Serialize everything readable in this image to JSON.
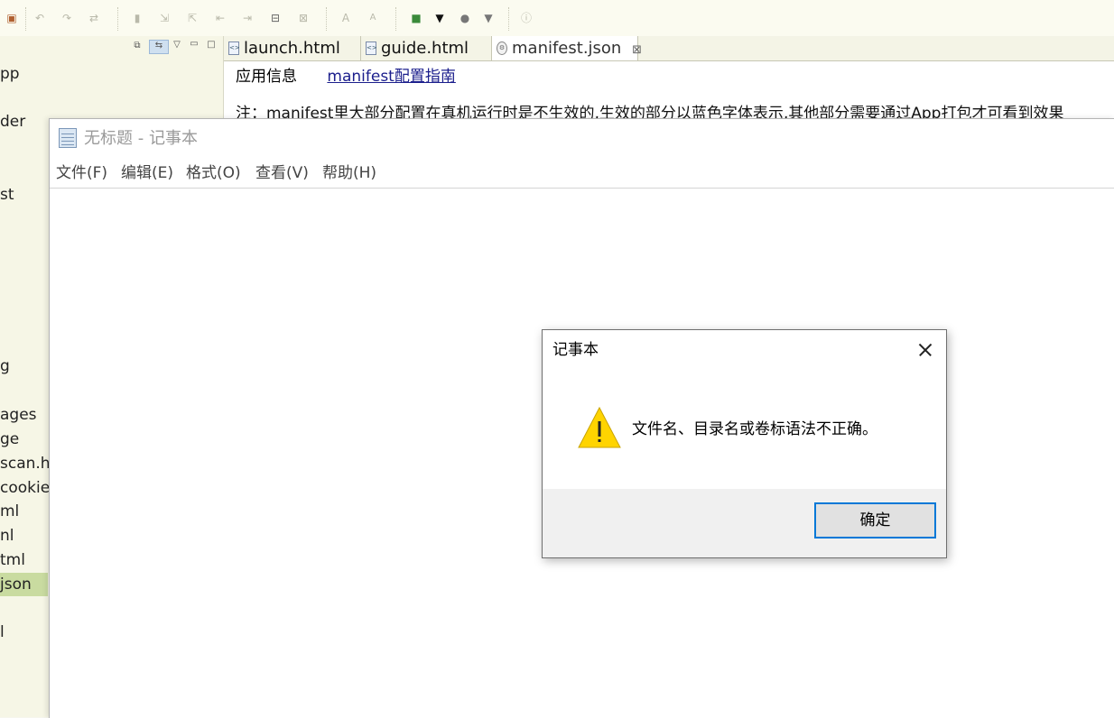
{
  "ide": {
    "toolbar": {
      "icons": [
        "save-all-icon",
        "undo-icon",
        "redo-icon",
        "run-icon",
        "bookmark-icon",
        "import-icon",
        "export-icon",
        "step-in-icon",
        "step-out-icon",
        "comment-icon",
        "uncomment-icon",
        "font-increase-icon",
        "font-decrease-icon",
        "new-project-icon",
        "dropdown-icon",
        "settings-icon",
        "dropdown-icon",
        "info-icon"
      ]
    },
    "tree": {
      "items": [
        "pp",
        "der",
        "st",
        "g",
        "ages",
        "ge",
        "scan.h",
        "cookie.",
        "ml",
        "nl",
        "tml",
        "json",
        "l"
      ],
      "selected_index": 11
    },
    "tabs": [
      {
        "label": "launch.html",
        "active": false
      },
      {
        "label": "guide.html",
        "active": false
      },
      {
        "label": "manifest.json",
        "active": true,
        "close": "⊠"
      }
    ],
    "editor": {
      "section_label": "应用信息",
      "guide_link": "manifest配置指南",
      "note": "注：manifest里大部分配置在真机运行时是不生效的,生效的部分以蓝色字体表示,其他部分需要通过App打包才可看到效果"
    }
  },
  "notepad": {
    "title": "无标题 - 记事本",
    "menu": [
      "文件(F)",
      "编辑(E)",
      "格式(O)",
      "查看(V)",
      "帮助(H)"
    ],
    "content": ""
  },
  "dialog": {
    "title": "记事本",
    "icon": "warning-icon",
    "message": "文件名、目录名或卷标语法不正确。",
    "ok_label": "确定"
  },
  "colors": {
    "ide_background": "#f6f6ee",
    "tree_selection": "#c9dba0",
    "link": "#1b1e8c",
    "dialog_footer": "#f0f0f0",
    "ok_button_border": "#0078d7",
    "warning_fill": "#ffd400"
  }
}
